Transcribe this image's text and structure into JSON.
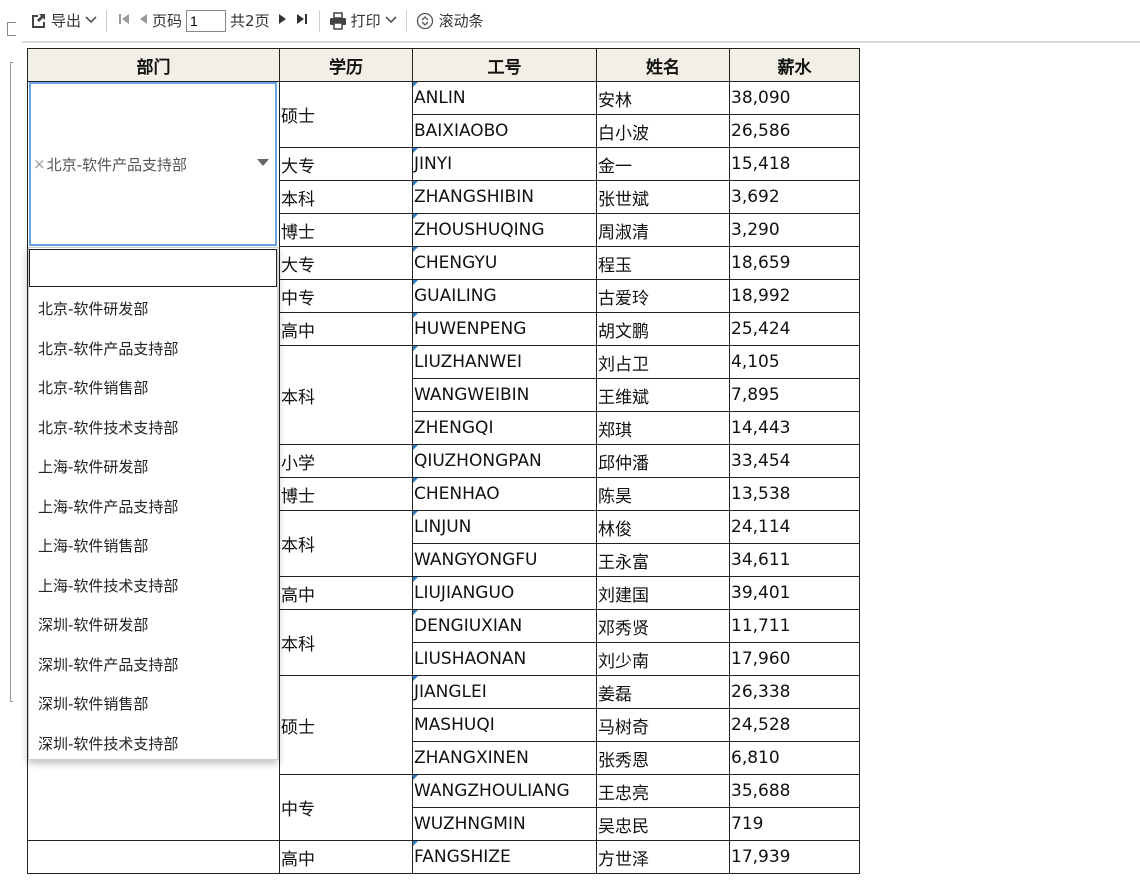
{
  "toolbar": {
    "export_label": "导出",
    "page_label": "页码",
    "page_value": "1",
    "total_pages": "共2页",
    "print_label": "打印",
    "scroll_label": "滚动条"
  },
  "table": {
    "headers": [
      "部门",
      "学历",
      "工号",
      "姓名",
      "薪水"
    ]
  },
  "dept_select": {
    "selected": "北京-软件产品支持部",
    "search_value": "",
    "options": [
      "北京-软件研发部",
      "北京-软件产品支持部",
      "北京-软件销售部",
      "北京-软件技术支持部",
      "上海-软件研发部",
      "上海-软件产品支持部",
      "上海-软件销售部",
      "上海-软件技术支持部",
      "深圳-软件研发部",
      "深圳-软件产品支持部",
      "深圳-软件销售部",
      "深圳-软件技术支持部"
    ]
  },
  "rows": [
    {
      "edu": "硕士",
      "id": "ANLIN",
      "name": "安林",
      "salary": "38,090"
    },
    {
      "edu": "硕士",
      "id": "BAIXIAOBO",
      "name": "白小波",
      "salary": "26,586"
    },
    {
      "edu": "大专",
      "id": "JINYI",
      "name": "金一",
      "salary": "15,418"
    },
    {
      "edu": "本科",
      "id": "ZHANGSHIBIN",
      "name": "张世斌",
      "salary": "3,692"
    },
    {
      "edu": "博士",
      "id": "ZHOUSHUQING",
      "name": "周淑清",
      "salary": "3,290"
    },
    {
      "edu": "大专",
      "id": "CHENGYU",
      "name": "程玉",
      "salary": "18,659"
    },
    {
      "edu": "中专",
      "id": "GUAILING",
      "name": "古爱玲",
      "salary": "18,992"
    },
    {
      "edu": "高中",
      "id": "HUWENPENG",
      "name": "胡文鹏",
      "salary": "25,424"
    },
    {
      "edu": "本科",
      "id": "LIUZHANWEI",
      "name": "刘占卫",
      "salary": "4,105"
    },
    {
      "edu": "本科",
      "id": "WANGWEIBIN",
      "name": "王维斌",
      "salary": "7,895"
    },
    {
      "edu": "本科",
      "id": "ZHENGQI",
      "name": "郑琪",
      "salary": "14,443"
    },
    {
      "edu": "小学",
      "id": "QIUZHONGPAN",
      "name": "邱仲潘",
      "salary": "33,454"
    },
    {
      "edu": "博士",
      "id": "CHENHAO",
      "name": "陈昊",
      "salary": "13,538"
    },
    {
      "edu": "本科",
      "id": "LINJUN",
      "name": "林俊",
      "salary": "24,114"
    },
    {
      "edu": "本科",
      "id": "WANGYONGFU",
      "name": "王永富",
      "salary": "34,611"
    },
    {
      "edu": "高中",
      "id": "LIUJIANGUO",
      "name": "刘建国",
      "salary": "39,401"
    },
    {
      "edu": "本科",
      "id": "DENGIUXIAN",
      "name": "邓秀贤",
      "salary": "11,711"
    },
    {
      "edu": "本科",
      "id": "LIUSHAONAN",
      "name": "刘少南",
      "salary": "17,960"
    },
    {
      "edu": "硕士",
      "id": "JIANGLEI",
      "name": "姜磊",
      "salary": "26,338"
    },
    {
      "edu": "硕士",
      "id": "MASHUQI",
      "name": "马树奇",
      "salary": "24,528"
    },
    {
      "edu": "硕士",
      "id": "ZHANGXINEN",
      "name": "张秀恩",
      "salary": "6,810"
    },
    {
      "edu": "中专",
      "id": "WANGZHOULIANG",
      "name": "王忠亮",
      "salary": "35,688"
    },
    {
      "edu": "中专",
      "id": "WUZHNGMIN",
      "name": "吴忠民",
      "salary": "719"
    },
    {
      "edu": "高中",
      "id": "FANGSHIZE",
      "name": "方世泽",
      "salary": "17,939"
    }
  ]
}
